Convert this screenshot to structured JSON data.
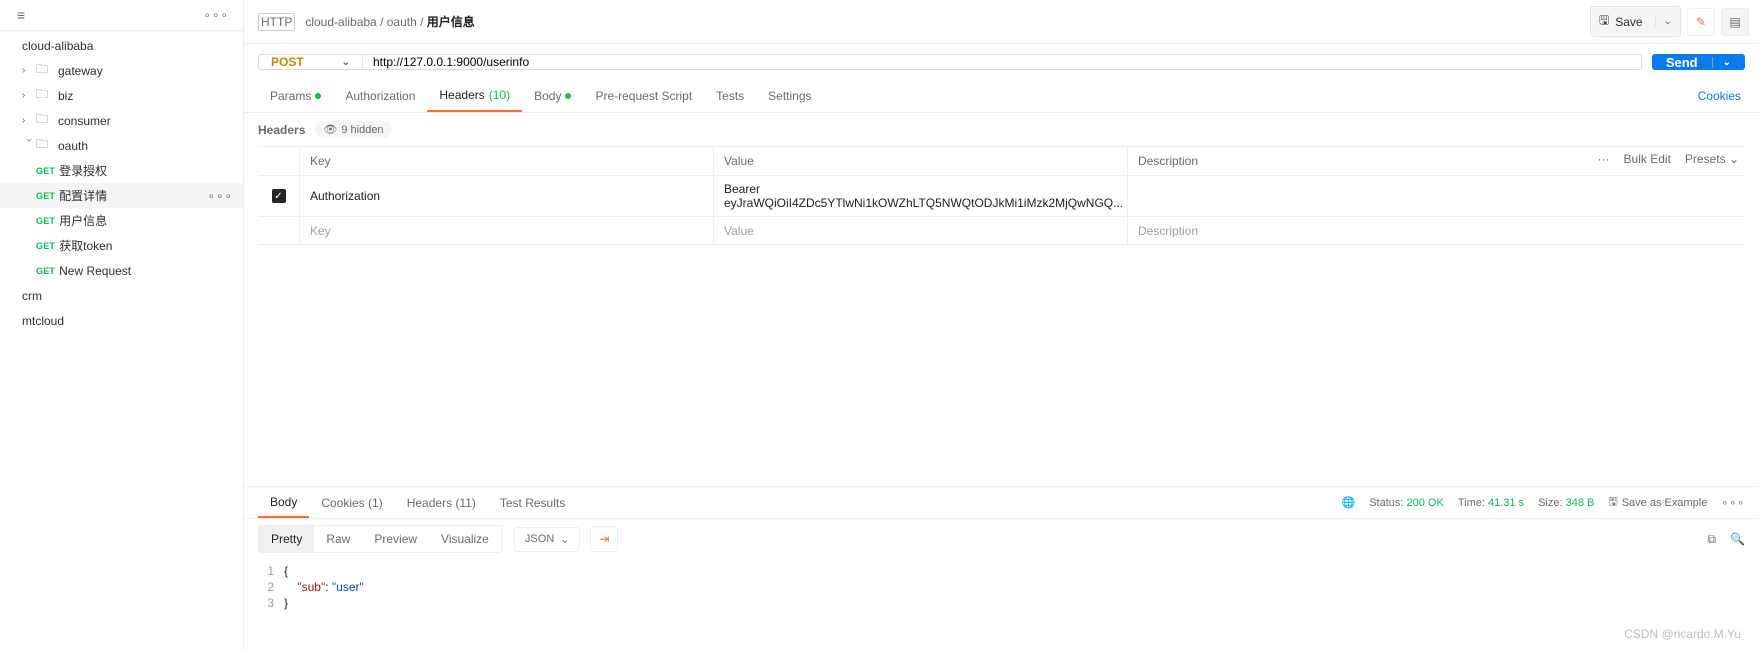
{
  "sidebar": {
    "filter_placeholder": "",
    "collections": [
      {
        "name": "cloud-alibaba",
        "open": true,
        "children": [
          {
            "type": "folder",
            "name": "gateway"
          },
          {
            "type": "folder",
            "name": "biz"
          },
          {
            "type": "folder",
            "name": "consumer"
          },
          {
            "type": "folder",
            "name": "oauth",
            "open": true,
            "children": [
              {
                "method": "GET",
                "name": "登录授权"
              },
              {
                "method": "GET",
                "name": "配置详情",
                "active_row": true
              },
              {
                "method": "GET",
                "name": "用户信息",
                "active": true
              },
              {
                "method": "GET",
                "name": "获取token"
              },
              {
                "method": "GET",
                "name": "New Request"
              }
            ]
          }
        ]
      },
      {
        "name": "crm"
      },
      {
        "name": "mtcloud"
      }
    ]
  },
  "breadcrumb": {
    "parts": [
      "cloud-alibaba",
      "oauth"
    ],
    "current": "用户信息"
  },
  "toolbar": {
    "save": "Save"
  },
  "request": {
    "method": "POST",
    "url": "http://127.0.0.1:9000/userinfo",
    "send": "Send",
    "tabs": {
      "params": "Params",
      "authorization": "Authorization",
      "headers": "Headers",
      "headers_count": "(10)",
      "body": "Body",
      "prerequest": "Pre-request Script",
      "tests": "Tests",
      "settings": "Settings",
      "cookies": "Cookies"
    }
  },
  "headers_section": {
    "label": "Headers",
    "hidden": "9 hidden",
    "columns": {
      "key": "Key",
      "value": "Value",
      "description": "Description"
    },
    "actions": {
      "bulk_edit": "Bulk Edit",
      "presets": "Presets"
    },
    "rows": [
      {
        "enabled": true,
        "key": "Authorization",
        "value": "Bearer eyJraWQiOiI4ZDc5YTlwNi1kOWZhLTQ5NWQtODJkMi1iMzk2MjQwNGQ...",
        "description": ""
      }
    ],
    "empty_row": {
      "key": "Key",
      "value": "Value",
      "description": "Description"
    }
  },
  "response": {
    "tabs": {
      "body": "Body",
      "cookies": "Cookies (1)",
      "headers": "Headers (11)",
      "test_results": "Test Results"
    },
    "status_label": "Status:",
    "status_value": "200 OK",
    "time_label": "Time:",
    "time_value": "41.31 s",
    "size_label": "Size:",
    "size_value": "348 B",
    "save_example": "Save as Example",
    "view_modes": {
      "pretty": "Pretty",
      "raw": "Raw",
      "preview": "Preview",
      "visualize": "Visualize"
    },
    "format": "JSON",
    "body_lines": [
      "{",
      "    \"sub\": \"user\"",
      "}"
    ]
  },
  "watermark": "CSDN @ricardo.M.Yu"
}
